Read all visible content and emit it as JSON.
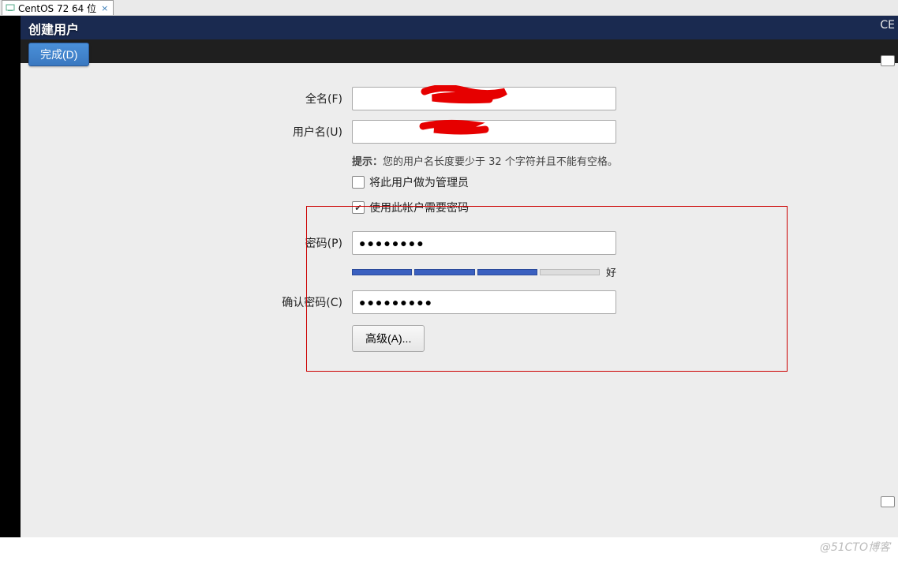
{
  "vm": {
    "tab_label": "CentOS 72 64 位",
    "tab_close": "×"
  },
  "header": {
    "title": "创建用户",
    "done_label": "完成(D)",
    "topright": "CE"
  },
  "form": {
    "fullname_label": "全名(F)",
    "fullname_value": "",
    "username_label": "用户名(U)",
    "username_value": "",
    "username_hint_prefix": "提示：",
    "username_hint": "您的用户名长度要少于 32 个字符并且不能有空格。",
    "admin_checkbox_label": "将此用户做为管理员",
    "admin_checked": false,
    "require_pw_checkbox_label": "使用此帐户需要密码",
    "require_pw_checked": true,
    "password_label": "密码(P)",
    "password_value": "●●●●●●●●",
    "strength_label": "好",
    "strength_segments_on": 3,
    "confirm_label": "确认密码(C)",
    "confirm_value": "●●●●●●●●●",
    "advanced_label": "高级(A)..."
  },
  "watermark": "@51CTO博客"
}
